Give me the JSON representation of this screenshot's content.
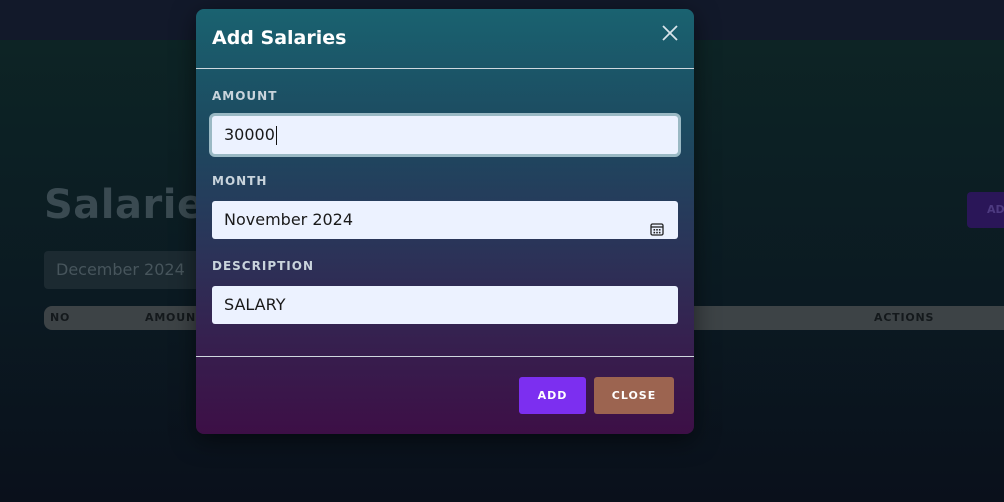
{
  "background": {
    "page_title": "Salaries",
    "filter_value": "December 2024",
    "add_button_label": "AD",
    "table_headers": [
      "NO",
      "AMOUNT",
      "ACTIONS"
    ]
  },
  "modal": {
    "title": "Add Salaries",
    "close_icon": "close-icon",
    "fields": {
      "amount": {
        "label": "AMOUNT",
        "value": "30000"
      },
      "month": {
        "label": "MONTH",
        "value": "November 2024",
        "icon": "calendar-icon"
      },
      "description": {
        "label": "DESCRIPTION",
        "value": "SALARY"
      }
    },
    "buttons": {
      "add": "ADD",
      "close": "CLOSE"
    }
  },
  "colors": {
    "add_button": "#7c2ff0",
    "close_button": "#9c6450",
    "field_bg": "#ecf2ff"
  }
}
